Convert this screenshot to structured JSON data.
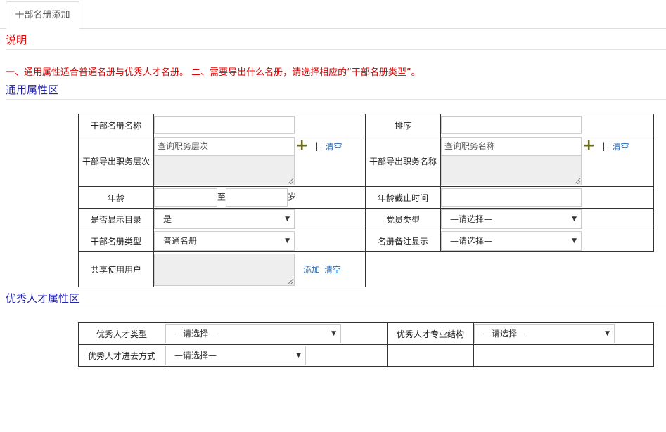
{
  "tab": {
    "label": "干部名册添加"
  },
  "sections": {
    "description": "说明",
    "note": "一、通用属性适合普通名册与优秀人才名册。 二、需要导出什么名册，请选择相应的“干部名册类型”。",
    "general": "通用属性区",
    "talent": "优秀人才属性区"
  },
  "general_form": {
    "roster_name_label": "干部名册名称",
    "sort_label": "排序",
    "export_level_label": "干部导出职务层次",
    "level_placeholder": "查询职务层次",
    "export_title_label": "干部导出职务名称",
    "title_placeholder": "查询职务名称",
    "clear": "清空",
    "add": "添加",
    "age_label": "年龄",
    "age_to": "至",
    "age_unit": "岁",
    "age_cutoff_label": "年龄截止时间",
    "show_dir_label": "是否显示目录",
    "show_dir_value": "是",
    "party_type_label": "党员类型",
    "party_type_value": "—请选择—",
    "roster_type_label": "干部名册类型",
    "roster_type_value": "普通名册",
    "remark_label": "名册备注显示",
    "remark_value": "—请选择—",
    "share_label": "共享使用用户"
  },
  "talent_form": {
    "type_label": "优秀人才类型",
    "type_value": "—请选择—",
    "struct_label": "优秀人才专业结构",
    "struct_value": "—请选择—",
    "entry_label": "优秀人才进去方式",
    "entry_value": "—请选择—"
  },
  "icons": {
    "select_caret": "triangle-down",
    "add": "plus-icon"
  }
}
